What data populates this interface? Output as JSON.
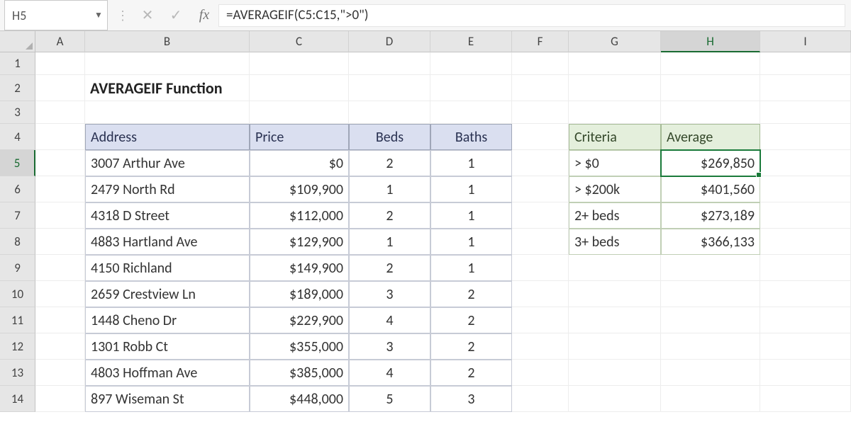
{
  "name_box": "H5",
  "formula": "=AVERAGEIF(C5:C15,\">0\")",
  "columns": [
    "A",
    "B",
    "C",
    "D",
    "E",
    "F",
    "G",
    "H",
    "I"
  ],
  "rows": [
    "1",
    "2",
    "3",
    "4",
    "5",
    "6",
    "7",
    "8",
    "9",
    "10",
    "11",
    "12",
    "13",
    "14"
  ],
  "title": "AVERAGEIF Function",
  "table1": {
    "headers": {
      "address": "Address",
      "price": "Price",
      "beds": "Beds",
      "baths": "Baths"
    },
    "rows": [
      {
        "address": "3007 Arthur Ave",
        "price": "$0",
        "beds": "2",
        "baths": "1"
      },
      {
        "address": "2479 North Rd",
        "price": "$109,900",
        "beds": "1",
        "baths": "1"
      },
      {
        "address": "4318 D Street",
        "price": "$112,000",
        "beds": "2",
        "baths": "1"
      },
      {
        "address": "4883 Hartland Ave",
        "price": "$129,900",
        "beds": "1",
        "baths": "1"
      },
      {
        "address": "4150 Richland",
        "price": "$149,900",
        "beds": "2",
        "baths": "1"
      },
      {
        "address": "2659 Crestview Ln",
        "price": "$189,000",
        "beds": "3",
        "baths": "2"
      },
      {
        "address": "1448 Cheno Dr",
        "price": "$229,900",
        "beds": "4",
        "baths": "2"
      },
      {
        "address": "1301 Robb Ct",
        "price": "$355,000",
        "beds": "3",
        "baths": "2"
      },
      {
        "address": "4803 Hoffman Ave",
        "price": "$385,000",
        "beds": "4",
        "baths": "2"
      },
      {
        "address": "897 Wiseman St",
        "price": "$448,000",
        "beds": "5",
        "baths": "3"
      }
    ]
  },
  "table2": {
    "headers": {
      "criteria": "Criteria",
      "average": "Average"
    },
    "rows": [
      {
        "criteria": "> $0",
        "average": "$269,850"
      },
      {
        "criteria": "> $200k",
        "average": "$401,560"
      },
      {
        "criteria": "2+ beds",
        "average": "$273,189"
      },
      {
        "criteria": "3+ beds",
        "average": "$366,133"
      }
    ]
  },
  "active_col": "H",
  "active_row": "5",
  "fx_label": "fx"
}
